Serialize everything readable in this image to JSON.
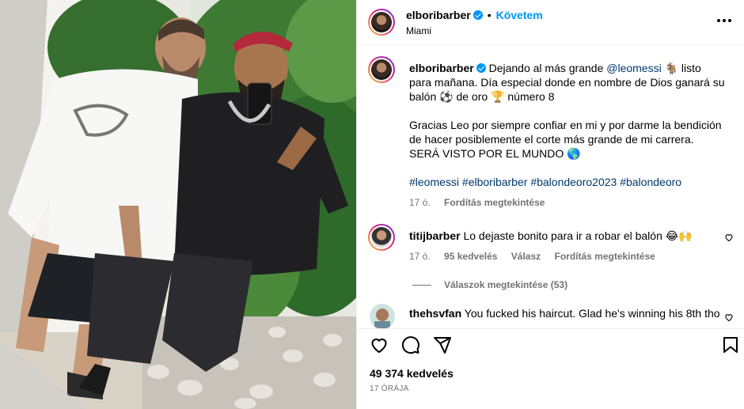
{
  "post": {
    "username": "elboribarber",
    "follow_label": "Követem",
    "location": "Miami"
  },
  "caption": {
    "username": "elboribarber",
    "text_1": "Dejando al más grande ",
    "mention": "@leomessi",
    "text_2": " 🐐 listo para mañana. Día especial donde en nombre de Dios ganará su balón ⚽ de oro 🏆 número 8",
    "paragraph_2": "Gracias Leo por siempre confiar en mi y por darme la bendición de hacer posiblemente el corte más grande de mi carrera. SERÁ VISTO POR EL MUNDO 🌎",
    "hashtags": [
      "#leomessi",
      "#elboribarber",
      "#balondeoro2023",
      "#balondeoro"
    ],
    "time": "17 ó.",
    "translate": "Fordítás megtekintése"
  },
  "comments": [
    {
      "username": "titijbarber",
      "text": "Lo dejaste bonito para ir a robar el balón 😂🙌",
      "time": "17 ó.",
      "likes": "95 kedvelés",
      "reply": "Válasz",
      "translate": "Fordítás megtekintése",
      "replies": "Válaszok megtekintése (53)"
    },
    {
      "username": "thehsvfan",
      "text": "You fucked his haircut. Glad he's winning his 8th tho"
    }
  ],
  "actions": {
    "likes": "49 374 kedvelés",
    "date": "17 ÓRÁJA"
  },
  "icons": [
    "more-icon",
    "heart-icon",
    "comment-icon",
    "share-icon",
    "bookmark-icon",
    "verified-icon"
  ],
  "colors": {
    "link": "#0095f6",
    "hashtag": "#00376b",
    "muted": "#737373"
  }
}
